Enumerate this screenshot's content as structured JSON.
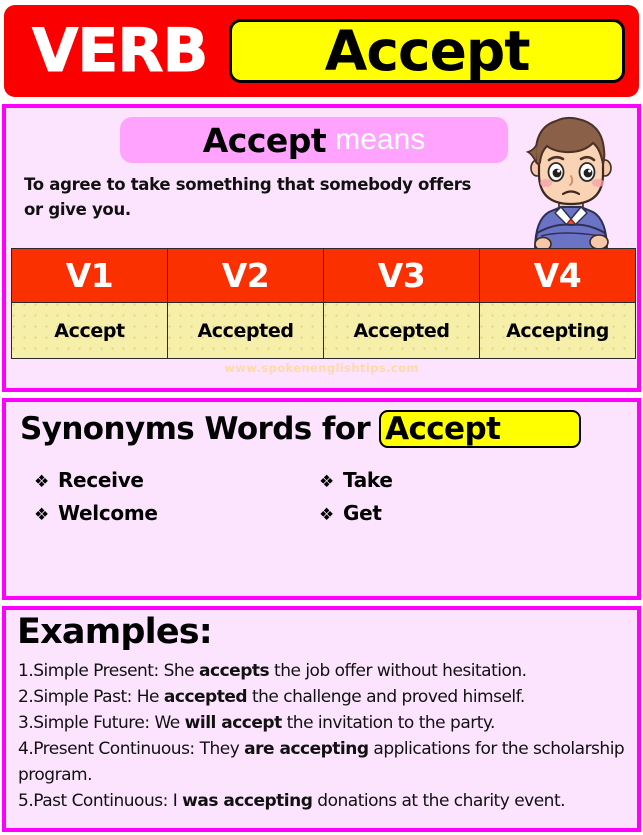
{
  "header": {
    "category_label": "VERB",
    "word": "Accept"
  },
  "meaning": {
    "pill_word": "Accept",
    "pill_suffix": "means",
    "definition": "To agree to take something that somebody offers or give you.",
    "character_alt": "cartoon-man-thinking"
  },
  "verb_table": {
    "headers": [
      "V1",
      "V2",
      "V3",
      "V4"
    ],
    "row": [
      "Accept",
      "Accepted",
      "Accepted",
      "Accepting"
    ],
    "watermark": "www.spokenenglishtips.com"
  },
  "synonyms": {
    "heading": "Synonyms Words for",
    "chip_word": "Accept",
    "bullet_glyph": "❖",
    "column_left": [
      "Receive",
      "Welcome"
    ],
    "column_right": [
      "Take",
      "Get"
    ]
  },
  "examples": {
    "heading": "Examples:",
    "items": [
      {
        "number": "1.",
        "tense": "Simple Present:",
        "before": " She ",
        "bold": "accepts",
        "after": " the job offer without hesitation."
      },
      {
        "number": "2.",
        "tense": "Simple Past:",
        "before": " He ",
        "bold": "accepted",
        "after": " the challenge and proved himself."
      },
      {
        "number": "3.",
        "tense": "Simple Future:",
        "before": " We ",
        "bold": "will accept",
        "after": " the invitation to the party."
      },
      {
        "number": "4.",
        "tense": "Present Continuous:",
        "before": " They ",
        "bold": "are accepting",
        "after": " applications for the scholarship program."
      },
      {
        "number": "5.",
        "tense": "Past Continuous:",
        "before": " I ",
        "bold": "was accepting",
        "after": " donations at the charity event."
      }
    ]
  },
  "colors": {
    "header_red": "#fb0000",
    "table_header_red": "#fa3000",
    "chip_yellow": "#ffff00",
    "cell_yellow": "#f6efa9",
    "panel_border_magenta": "#ff00ff",
    "panel_bg_pink": "#fde4fe",
    "pill_pink": "#ffa3ff"
  }
}
